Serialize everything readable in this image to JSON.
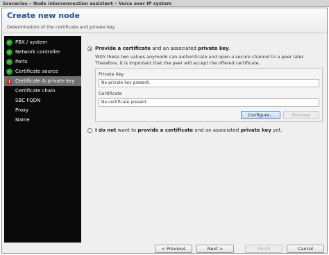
{
  "breadcrumb": {
    "items": [
      "Scenarios",
      "Node interconnection assistant",
      "Voice over IP system"
    ],
    "separator": "»"
  },
  "header": {
    "title": "Create new node",
    "subtitle": "Determination of the certificate and private key"
  },
  "sidebar": {
    "steps": [
      {
        "label": "PBX / system",
        "status": "ok",
        "icon": "check-icon"
      },
      {
        "label": "Network controller",
        "status": "ok",
        "icon": "check-icon"
      },
      {
        "label": "Ports",
        "status": "ok",
        "icon": "check-icon"
      },
      {
        "label": "Certificate source",
        "status": "ok",
        "icon": "check-icon"
      },
      {
        "label": "Certificate & private key",
        "status": "warning",
        "icon": "warning-icon",
        "active": true
      },
      {
        "label": "Certificate chain",
        "status": "none"
      },
      {
        "label": "SBC FQDN",
        "status": "none"
      },
      {
        "label": "Proxy",
        "status": "none"
      },
      {
        "label": "Name",
        "status": "none"
      }
    ]
  },
  "options": {
    "provide": {
      "prefix": "Provide a certificate",
      "middle": " and an associated ",
      "bold_end": "private key",
      "suffix": ".",
      "selected": true,
      "description": "With these two values anymode can authenticate and open a secure channel to a peer later. Therefore, it is important that the peer will accept the offered certificate."
    },
    "skip": {
      "prefix": "I do not",
      "middle1": " want to ",
      "bold_mid": "provide a certificate",
      "middle2": " and an associated ",
      "bold_end": "private key",
      "suffix": " yet.",
      "selected": false
    }
  },
  "fields": {
    "private_key_label": "Private Key",
    "private_key_value": "No private key present.",
    "certificate_label": "Certificate",
    "certificate_value": "No certificate present."
  },
  "buttons": {
    "configure": "Configure...",
    "remove": "Remove",
    "previous": "< Previous",
    "next": "Next >",
    "finish": "Finish",
    "cancel": "Cancel"
  },
  "colors": {
    "title": "#2a4f92",
    "sidebar_bg": "#0a0a0a",
    "active_step": "#6f6f6f",
    "ok": "#2aa32a",
    "warning": "#d12020"
  }
}
